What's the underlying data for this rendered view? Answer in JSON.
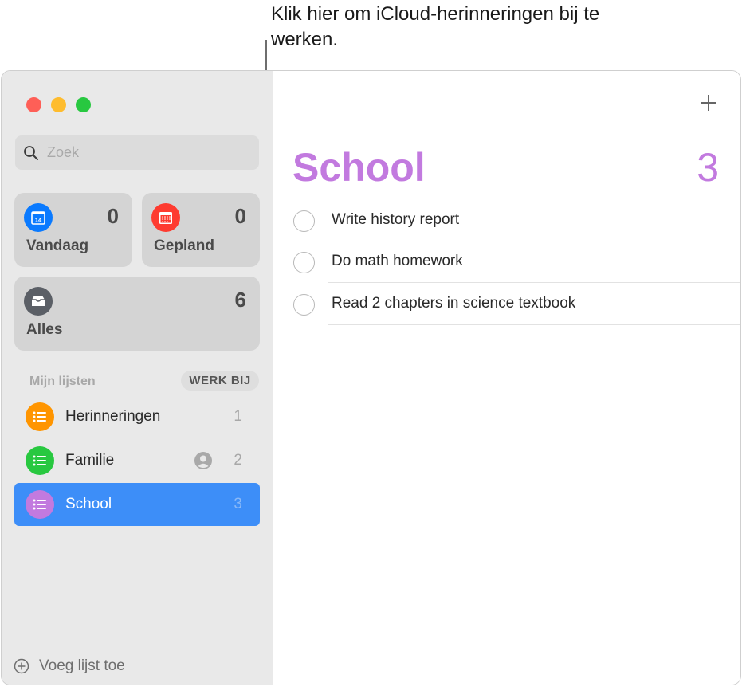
{
  "callout": {
    "text": "Klik hier om iCloud-herinneringen bij te werken."
  },
  "sidebar": {
    "search": {
      "placeholder": "Zoek",
      "value": ""
    },
    "smart_lists": [
      {
        "label": "Vandaag",
        "count": "0",
        "icon": "calendar-today-icon",
        "color": "#0a7aff",
        "day": "14"
      },
      {
        "label": "Gepland",
        "count": "0",
        "icon": "calendar-scheduled-icon",
        "color": "#fe3b30"
      },
      {
        "label": "Alles",
        "count": "6",
        "icon": "tray-icon",
        "color": "#5b5f66"
      }
    ],
    "section_header": "Mijn lijsten",
    "update_button": "WERK BIJ",
    "lists": [
      {
        "label": "Herinneringen",
        "count": "1",
        "color": "#ff9500",
        "shared": false
      },
      {
        "label": "Familie",
        "count": "2",
        "color": "#28c840",
        "shared": true
      },
      {
        "label": "School",
        "count": "3",
        "color": "#c27adf",
        "shared": false,
        "selected": true
      }
    ],
    "add_list_label": "Voeg lijst toe"
  },
  "content": {
    "title": "School",
    "total": "3",
    "accent_color": "#c27adf",
    "tasks": [
      {
        "text": "Write history report",
        "completed": false
      },
      {
        "text": "Do math homework",
        "completed": false
      },
      {
        "text": "Read 2 chapters in science textbook",
        "completed": false
      }
    ]
  },
  "colors": {
    "selection": "#3d8ef8",
    "close": "#fe5f57",
    "minimize": "#febc2e",
    "maximize": "#28c840"
  }
}
